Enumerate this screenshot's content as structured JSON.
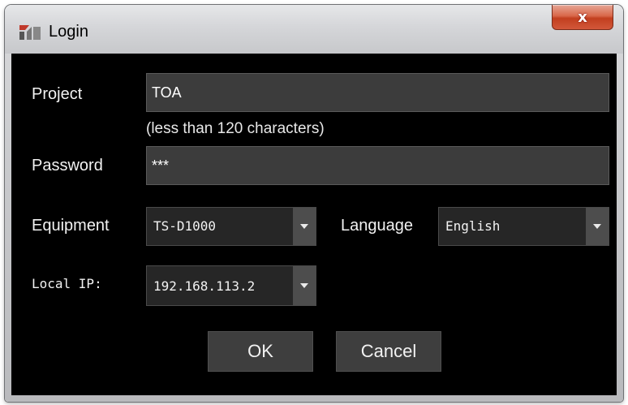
{
  "window": {
    "title": "Login",
    "close_label": "x"
  },
  "form": {
    "project_label": "Project",
    "project_value": "TOA",
    "project_hint": "(less than 120 characters)",
    "password_label": "Password",
    "password_value": "***",
    "equipment_label": "Equipment",
    "equipment_value": "TS-D1000",
    "language_label": "Language",
    "language_value": "English",
    "local_ip_label": "Local IP:",
    "local_ip_value": "192.168.113.2"
  },
  "buttons": {
    "ok": "OK",
    "cancel": "Cancel"
  },
  "icons": {
    "app": "app-logo-icon",
    "close": "close-icon",
    "dropdown": "chevron-down-icon"
  },
  "colors": {
    "client_bg": "#000000",
    "field_bg": "#3c3c3c",
    "close_btn": "#c9442a"
  }
}
